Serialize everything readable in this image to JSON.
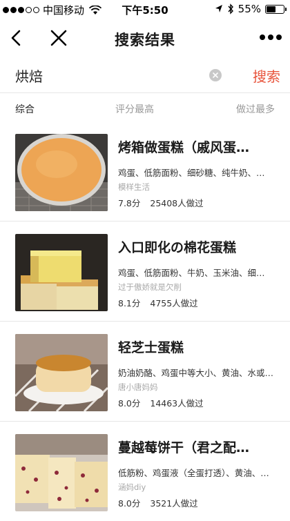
{
  "status_bar": {
    "carrier": "中国移动",
    "time": "下午5:50",
    "battery": "55%",
    "battery_level": 0.55,
    "signal_bars": 3
  },
  "nav": {
    "title": "搜索结果"
  },
  "search": {
    "value": "烘焙",
    "button_label": "搜索"
  },
  "sort_tabs": [
    {
      "label": "综合",
      "active": true
    },
    {
      "label": "评分最高",
      "active": false
    },
    {
      "label": "做过最多",
      "active": false
    }
  ],
  "recipes": [
    {
      "title": "烤箱做蛋糕（戚风蛋…",
      "ingredients": "鸡蛋、低筋面粉、细砂糖、纯牛奶、…",
      "author": "模样生活",
      "score": "7.8分",
      "made_count": "25408人做过"
    },
    {
      "title": "入口即化の棉花蛋糕",
      "ingredients": "鸡蛋、低筋面粉、牛奶、玉米油、细…",
      "author": "过于傲娇就是欠削",
      "score": "8.1分",
      "made_count": "4755人做过"
    },
    {
      "title": "轻芝士蛋糕",
      "ingredients": "奶油奶酪、鸡蛋中等大小、黄油、水或…",
      "author": "唐小唐妈妈",
      "score": "8.0分",
      "made_count": "14463人做过"
    },
    {
      "title": "蔓越莓饼干（君之配…",
      "ingredients": "低筋粉、鸡蛋液（全蛋打透）、黄油、…",
      "author": "涵妈diy",
      "score": "8.0分",
      "made_count": "3521人做过"
    }
  ],
  "colors": {
    "accent": "#e8553d",
    "muted_text": "#999999",
    "divider": "#e6e6e6"
  }
}
